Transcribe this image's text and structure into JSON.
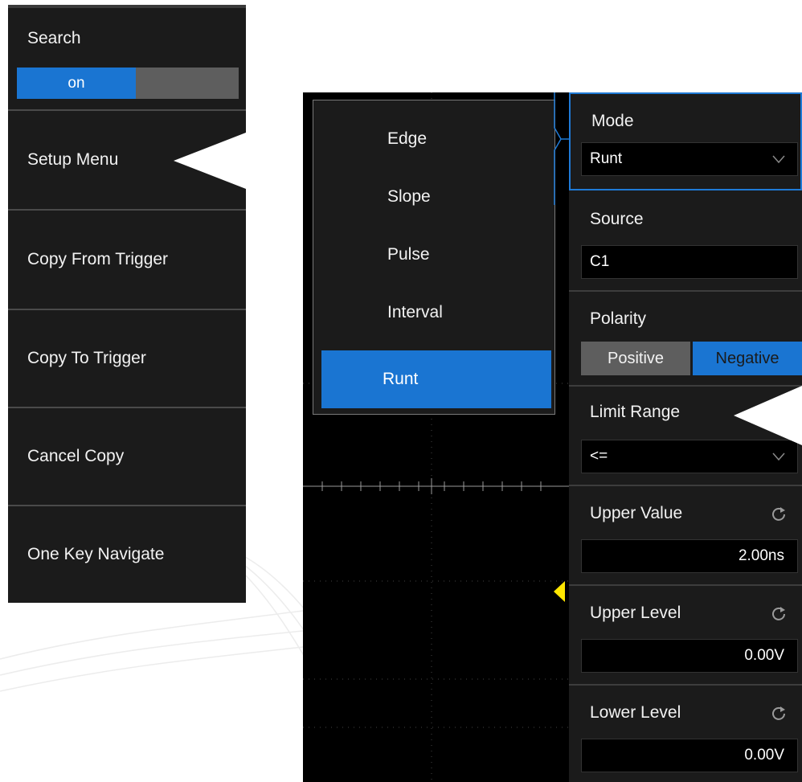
{
  "left_menu": {
    "search": {
      "label": "Search",
      "state": "on"
    },
    "items": [
      {
        "label": "Setup Menu"
      },
      {
        "label": "Copy From Trigger"
      },
      {
        "label": "Copy To Trigger"
      },
      {
        "label": "Cancel Copy"
      },
      {
        "label": "One Key Navigate"
      }
    ]
  },
  "trigger_type_menu": {
    "items": [
      {
        "label": "Edge"
      },
      {
        "label": "Slope"
      },
      {
        "label": "Pulse"
      },
      {
        "label": "Interval"
      },
      {
        "label": "Runt"
      }
    ],
    "selected": "Runt"
  },
  "params": {
    "mode": {
      "label": "Mode",
      "value": "Runt"
    },
    "source": {
      "label": "Source",
      "value": "C1"
    },
    "polarity": {
      "label": "Polarity",
      "options": [
        "Positive",
        "Negative"
      ],
      "selected": "Negative"
    },
    "limit_range": {
      "label": "Limit Range",
      "value": "<="
    },
    "upper_value": {
      "label": "Upper Value",
      "value": "2.00ns"
    },
    "upper_level": {
      "label": "Upper Level",
      "value": "0.00V"
    },
    "lower_level": {
      "label": "Lower Level",
      "value": "0.00V"
    }
  },
  "colors": {
    "accent_blue": "#1a75d2",
    "panel_bg": "#1b1b1b",
    "toggle_off": "#5e5e5e",
    "trigger_marker": "#ffe600"
  },
  "icons": {
    "dropdown": "chevron-down-icon",
    "reset": "reset-icon",
    "pointer": "arrow-left-pointer-icon",
    "trigger_level": "trigger-level-marker-icon"
  }
}
